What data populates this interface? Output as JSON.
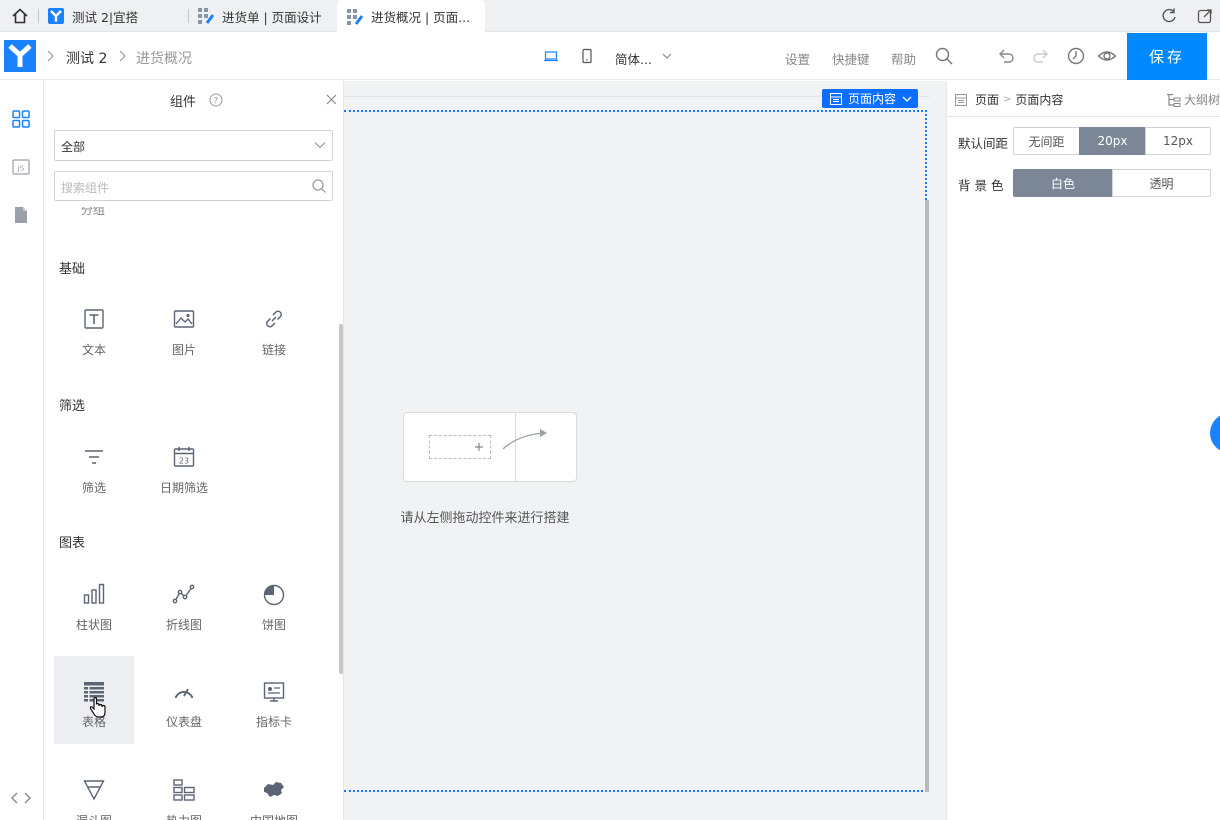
{
  "browser": {
    "tabs": [
      {
        "title": "测试 2|宜搭"
      },
      {
        "title": "进货单 | 页面设计"
      },
      {
        "title": "进货概况 | 页面..."
      }
    ]
  },
  "header": {
    "app_name": "测试 2",
    "page_name": "进货概况",
    "language": "简体...",
    "settings": "设置",
    "shortcuts": "快捷键",
    "help": "帮助",
    "save": "保存",
    "brand_color": "#0089ff"
  },
  "panel": {
    "title": "组件",
    "filter": "全部",
    "search_placeholder": "搜索组件",
    "cut_label": "分组",
    "sections": [
      {
        "title": "基础",
        "items": [
          {
            "label": "文本",
            "icon": "text-icon"
          },
          {
            "label": "图片",
            "icon": "image-icon"
          },
          {
            "label": "链接",
            "icon": "link-icon"
          }
        ]
      },
      {
        "title": "筛选",
        "items": [
          {
            "label": "筛选",
            "icon": "filter-icon"
          },
          {
            "label": "日期筛选",
            "icon": "calendar-icon"
          }
        ]
      },
      {
        "title": "图表",
        "items": [
          {
            "label": "柱状图",
            "icon": "bar-chart-icon"
          },
          {
            "label": "折线图",
            "icon": "line-chart-icon"
          },
          {
            "label": "饼图",
            "icon": "pie-chart-icon"
          },
          {
            "label": "表格",
            "icon": "table-icon"
          },
          {
            "label": "仪表盘",
            "icon": "gauge-icon"
          },
          {
            "label": "指标卡",
            "icon": "kpi-card-icon"
          },
          {
            "label": "漏斗图",
            "icon": "funnel-icon"
          },
          {
            "label": "热力图",
            "icon": "heatmap-icon"
          },
          {
            "label": "中国地图",
            "icon": "china-map-icon"
          }
        ]
      }
    ]
  },
  "canvas": {
    "page_tag": "页面内容",
    "hint": "请从左侧拖动控件来进行搭建"
  },
  "props": {
    "crumb_root": "页面",
    "crumb_current": "页面内容",
    "outline": "大纲树",
    "spacing_label": "默认间距",
    "spacing_options": [
      "无间距",
      "20px",
      "12px"
    ],
    "spacing_selected": "20px",
    "bg_label": "背 景 色",
    "bg_options": [
      "白色",
      "透明"
    ],
    "bg_selected": "白色"
  }
}
